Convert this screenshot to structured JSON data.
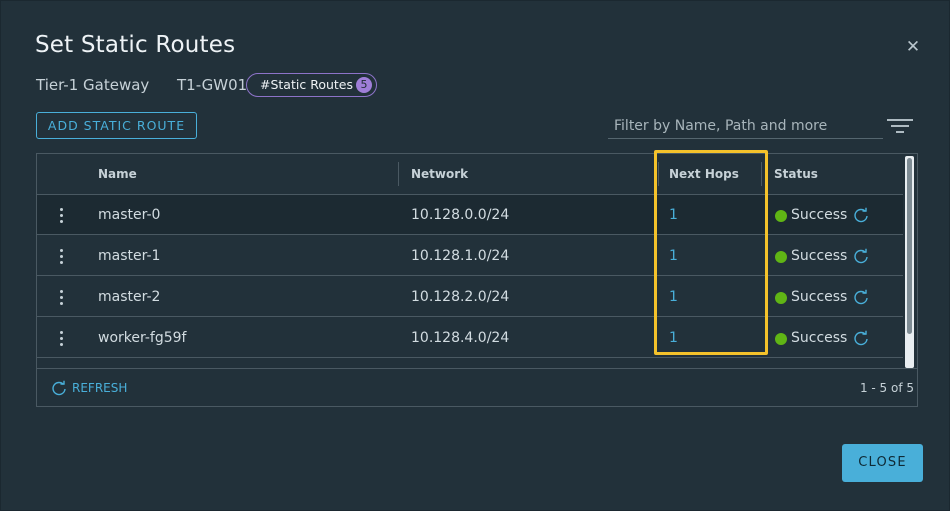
{
  "dialog": {
    "title": "Set Static Routes",
    "close_icon": "close-icon"
  },
  "context": {
    "gateway_label": "Tier-1 Gateway",
    "gateway_name": "T1-GW01",
    "pill_label": "#Static Routes",
    "pill_count": "5"
  },
  "toolbar": {
    "add_label": "ADD STATIC ROUTE",
    "filter_placeholder": "Filter by Name, Path and more",
    "filter_icon": "filter-lines-icon"
  },
  "table": {
    "columns": [
      "Name",
      "Network",
      "Next Hops",
      "Status"
    ],
    "rows": [
      {
        "name": "master-0",
        "network": "10.128.0.0/24",
        "next_hops": "1",
        "status": "Success"
      },
      {
        "name": "master-1",
        "network": "10.128.1.0/24",
        "next_hops": "1",
        "status": "Success"
      },
      {
        "name": "master-2",
        "network": "10.128.2.0/24",
        "next_hops": "1",
        "status": "Success"
      },
      {
        "name": "worker-fg59f",
        "network": "10.128.4.0/24",
        "next_hops": "1",
        "status": "Success"
      }
    ],
    "refresh_label": "REFRESH",
    "pagination": "1 - 5 of 5"
  },
  "footer": {
    "close_label": "CLOSE"
  },
  "colors": {
    "accent": "#49afd9",
    "success": "#60b515",
    "highlight": "#f4c22b",
    "pill": "#9f7ed8"
  }
}
